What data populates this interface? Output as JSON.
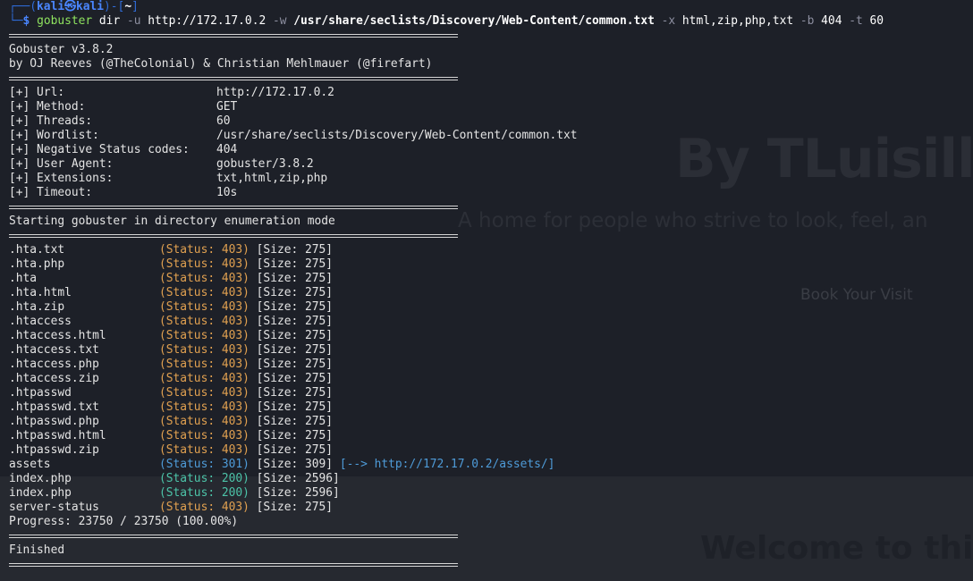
{
  "prompt": {
    "line1_open": "┌──(",
    "user": "kali",
    "at": "㉿",
    "host": "kali",
    "line1_close": ")-[",
    "dir": "~",
    "line1_end": "]",
    "line2_prefix": "└─",
    "symbol": "$"
  },
  "command": {
    "tool": "gobuster",
    "parts": [
      {
        "text": "dir",
        "style": "arg"
      },
      {
        "text": "-u",
        "style": "flag"
      },
      {
        "text": "http://172.17.0.2",
        "style": "arg"
      },
      {
        "text": "-w",
        "style": "flag"
      },
      {
        "text": "/usr/share/seclists/Discovery/Web-Content/common.txt",
        "style": "arg-bold"
      },
      {
        "text": "-x",
        "style": "flag"
      },
      {
        "text": "html,zip,php,txt",
        "style": "arg"
      },
      {
        "text": "-b",
        "style": "flag"
      },
      {
        "text": "404",
        "style": "arg"
      },
      {
        "text": "-t",
        "style": "flag"
      },
      {
        "text": "60",
        "style": "arg"
      }
    ]
  },
  "banner": {
    "version": "Gobuster v3.8.2",
    "authors": "by OJ Reeves (@TheColonial) & Christian Mehlmauer (@firefart)"
  },
  "config": [
    {
      "key": "[+] Url:",
      "value": "http://172.17.0.2"
    },
    {
      "key": "[+] Method:",
      "value": "GET"
    },
    {
      "key": "[+] Threads:",
      "value": "60"
    },
    {
      "key": "[+] Wordlist:",
      "value": "/usr/share/seclists/Discovery/Web-Content/common.txt"
    },
    {
      "key": "[+] Negative Status codes:",
      "value": "404"
    },
    {
      "key": "[+] User Agent:",
      "value": "gobuster/3.8.2"
    },
    {
      "key": "[+] Extensions:",
      "value": "txt,html,zip,php"
    },
    {
      "key": "[+] Timeout:",
      "value": "10s"
    }
  ],
  "starting_message": "Starting gobuster in directory enumeration mode",
  "results": [
    {
      "path": ".hta.txt",
      "status": "403",
      "size": "275"
    },
    {
      "path": ".hta.php",
      "status": "403",
      "size": "275"
    },
    {
      "path": ".hta",
      "status": "403",
      "size": "275"
    },
    {
      "path": ".hta.html",
      "status": "403",
      "size": "275"
    },
    {
      "path": ".hta.zip",
      "status": "403",
      "size": "275"
    },
    {
      "path": ".htaccess",
      "status": "403",
      "size": "275"
    },
    {
      "path": ".htaccess.html",
      "status": "403",
      "size": "275"
    },
    {
      "path": ".htaccess.txt",
      "status": "403",
      "size": "275"
    },
    {
      "path": ".htaccess.php",
      "status": "403",
      "size": "275"
    },
    {
      "path": ".htaccess.zip",
      "status": "403",
      "size": "275"
    },
    {
      "path": ".htpasswd",
      "status": "403",
      "size": "275"
    },
    {
      "path": ".htpasswd.txt",
      "status": "403",
      "size": "275"
    },
    {
      "path": ".htpasswd.php",
      "status": "403",
      "size": "275"
    },
    {
      "path": ".htpasswd.html",
      "status": "403",
      "size": "275"
    },
    {
      "path": ".htpasswd.zip",
      "status": "403",
      "size": "275"
    },
    {
      "path": "assets",
      "status": "301",
      "size": "309",
      "redirect": "[--> http://172.17.0.2/assets/]"
    },
    {
      "path": "index.php",
      "status": "200",
      "size": "2596"
    },
    {
      "path": "index.php",
      "status": "200",
      "size": "2596"
    },
    {
      "path": "server-status",
      "status": "403",
      "size": "275"
    }
  ],
  "progress": "Progress: 23750 / 23750 (100.00%)",
  "finished": "Finished",
  "background_site": {
    "title": "By TLuisillo",
    "tagline": "A home for people who strive to look, feel, an",
    "cta": "Book Your Visit",
    "welcome": "Welcome to this C"
  },
  "colors": {
    "background": "#1d2028",
    "status_403": "#e0a050",
    "status_301": "#4e9bd8",
    "status_200": "#4cc3a8",
    "command": "#8fe35f",
    "prompt": "#4a86ff"
  }
}
